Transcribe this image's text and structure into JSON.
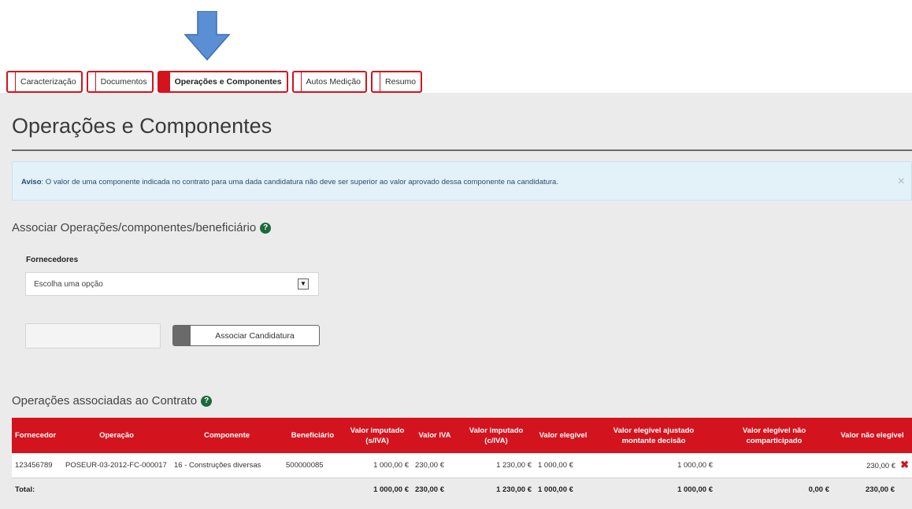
{
  "tabs": [
    {
      "label": "Caracterização",
      "active": false
    },
    {
      "label": "Documentos",
      "active": false
    },
    {
      "label": "Operações e Componentes",
      "active": true
    },
    {
      "label": "Autos Medição",
      "active": false
    },
    {
      "label": "Resumo",
      "active": false
    }
  ],
  "page_title": "Operações e Componentes",
  "alert": {
    "prefix": "Aviso",
    "text": ": O valor de uma componente indicada no contrato para uma dada candidatura não deve ser superior ao valor aprovado dessa componente na candidatura.",
    "close": "×"
  },
  "associate_section": {
    "title": "Associar Operações/componentes/beneficiário",
    "help": "?",
    "suppliers_label": "Fornecedores",
    "suppliers_selected": "Escolha uma opção",
    "dropdown_glyph": "▼",
    "button_label": "Associar Candidatura"
  },
  "ops_section": {
    "title": "Operações associadas ao Contrato",
    "help": "?"
  },
  "table": {
    "headers": {
      "fornecedor": "Fornecedor",
      "operacao": "Operação",
      "componente": "Componente",
      "beneficiario": "Beneficiário",
      "valor_imputado_siva_l1": "Valor imputado",
      "valor_imputado_siva_l2": "(s/IVA)",
      "valor_iva": "Valor IVA",
      "valor_imputado_civa_l1": "Valor imputado",
      "valor_imputado_civa_l2": "(c/IVA)",
      "valor_elegivel": "Valor elegível",
      "valor_elegivel_ajustado_l1": "Valor elegível ajustado",
      "valor_elegivel_ajustado_l2": "montante decisão",
      "valor_elegivel_nao_comp_l1": "Valor elegível não",
      "valor_elegivel_nao_comp_l2": "comparticipado",
      "valor_nao_elegivel": "Valor não elegível"
    },
    "row": {
      "fornecedor": "123456789",
      "operacao": "POSEUR-03-2012-FC-000017",
      "componente": "16 - Construções diversas",
      "beneficiario": "500000085",
      "valor_imputado_siva": "1 000,00 €",
      "valor_iva": "230,00 €",
      "valor_imputado_civa": "1 230,00 €",
      "valor_elegivel": "1 000,00 €",
      "valor_elegivel_ajustado": "1 000,00 €",
      "valor_elegivel_nao_comp": "",
      "valor_nao_elegivel": "230,00 €",
      "delete_glyph": "✖"
    },
    "total": {
      "label": "Total:",
      "valor_imputado_siva": "1 000,00 €",
      "valor_iva": "230,00 €",
      "valor_imputado_civa": "1 230,00 €",
      "valor_elegivel": "1 000,00 €",
      "valor_elegivel_ajustado": "1 000,00 €",
      "valor_elegivel_nao_comp": "0,00 €",
      "valor_nao_elegivel": "230,00 €"
    }
  },
  "colors": {
    "accent": "#d3141e",
    "arrow": "#5b8fd4",
    "help_icon": "#1b6b3a"
  }
}
